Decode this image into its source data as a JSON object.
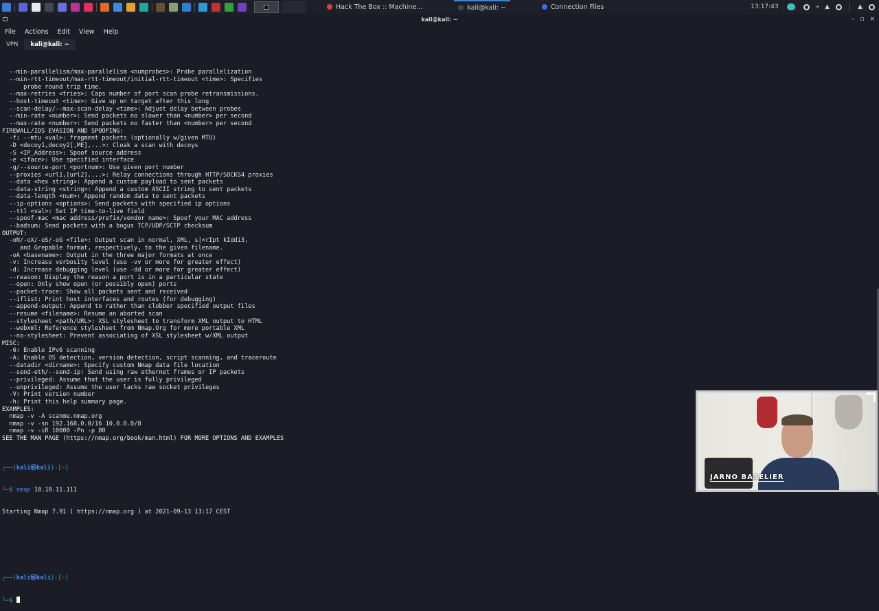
{
  "taskbar": {
    "icons": [
      {
        "name": "kali-menu-icon",
        "color": "#3b7bd6"
      },
      {
        "name": "workspace-icon",
        "color": "#5a63d8"
      },
      {
        "name": "file-manager-icon",
        "color": "#e8e8f0"
      },
      {
        "name": "terminal-icon",
        "color": "#444850"
      },
      {
        "name": "chat-icon",
        "color": "#6a6fe0"
      },
      {
        "name": "app-purple-icon",
        "color": "#c0309a"
      },
      {
        "name": "app-star-icon",
        "color": "#e03060"
      },
      {
        "name": "firefox-icon",
        "color": "#e06a20"
      },
      {
        "name": "browser-blue-icon",
        "color": "#3d8ae0"
      },
      {
        "name": "burp-icon",
        "color": "#e8a030"
      },
      {
        "name": "app-teal-icon",
        "color": "#1aa8a0"
      },
      {
        "name": "notes-icon",
        "color": "#6a5030"
      },
      {
        "name": "editor-icon",
        "color": "#8aa070"
      },
      {
        "name": "vscode-icon",
        "color": "#2d7fd0"
      },
      {
        "name": "app-cyan-icon",
        "color": "#2a9ad8"
      },
      {
        "name": "filezilla-icon",
        "color": "#c83030"
      },
      {
        "name": "lock-icon",
        "color": "#30a040"
      },
      {
        "name": "app-violet-icon",
        "color": "#7040c0"
      }
    ],
    "windows": [
      {
        "label": "Hack The Box :: Machine...",
        "color": "#e04040"
      },
      {
        "label": "kali@kali: ~",
        "color": "#444850"
      },
      {
        "label": "Connection Files",
        "color": "#3d6ee0"
      }
    ],
    "clock": "13:17:43"
  },
  "window": {
    "title": "kali@kali: ~",
    "controls": [
      "–",
      "▫",
      "×"
    ]
  },
  "menu": [
    "File",
    "Actions",
    "Edit",
    "View",
    "Help"
  ],
  "tabs": [
    {
      "label": "VPN"
    },
    {
      "label": "kali@kali: ~"
    }
  ],
  "terminal": {
    "lines": [
      {
        "t": "  --min-parallelism/max-parallelism <numprobes>: Probe parallelization"
      },
      {
        "t": "  --min-rtt-timeout/max-rtt-timeout/initial-rtt-timeout <time>: Specifies"
      },
      {
        "t": "      probe round trip time."
      },
      {
        "t": "  --max-retries <tries>: Caps number of port scan probe retransmissions."
      },
      {
        "t": "  --host-timeout <time>: Give up on target after this long"
      },
      {
        "t": "  --scan-delay/--max-scan-delay <time>: Adjust delay between probes"
      },
      {
        "t": "  --min-rate <number>: Send packets no slower than <number> per second"
      },
      {
        "t": "  --max-rate <number>: Send packets no faster than <number> per second"
      },
      {
        "t": "FIREWALL/IDS EVASION AND SPOOFING:"
      },
      {
        "t": "  -f; --mtu <val>: fragment packets (optionally w/given MTU)"
      },
      {
        "t": "  -D <decoy1,decoy2[,ME],...>: Cloak a scan with decoys"
      },
      {
        "t": "  -S <IP_Address>: Spoof source address"
      },
      {
        "t": "  -e <iface>: Use specified interface"
      },
      {
        "t": "  -g/--source-port <portnum>: Use given port number"
      },
      {
        "t": "  --proxies <url1,[url2],...>: Relay connections through HTTP/SOCKS4 proxies"
      },
      {
        "t": "  --data <hex string>: Append a custom payload to sent packets"
      },
      {
        "t": "  --data-string <string>: Append a custom ASCII string to sent packets"
      },
      {
        "t": "  --data-length <num>: Append random data to sent packets"
      },
      {
        "t": "  --ip-options <options>: Send packets with specified ip options"
      },
      {
        "t": "  --ttl <val>: Set IP time-to-live field"
      },
      {
        "t": "  --spoof-mac <mac address/prefix/vendor name>: Spoof your MAC address"
      },
      {
        "t": "  --badsum: Send packets with a bogus TCP/UDP/SCTP checksum"
      },
      {
        "t": "OUTPUT:"
      },
      {
        "t": "  -oN/-oX/-oS/-oG <file>: Output scan in normal, XML, s|<rIpt kIddi3,"
      },
      {
        "t": "     and Grepable format, respectively, to the given filename."
      },
      {
        "t": "  -oA <basename>: Output in the three major formats at once"
      },
      {
        "t": "  -v: Increase verbosity level (use -vv or more for greater effect)"
      },
      {
        "t": "  -d: Increase debugging level (use -dd or more for greater effect)"
      },
      {
        "t": "  --reason: Display the reason a port is in a particular state"
      },
      {
        "t": "  --open: Only show open (or possibly open) ports"
      },
      {
        "t": "  --packet-trace: Show all packets sent and received"
      },
      {
        "t": "  --iflist: Print host interfaces and routes (for debugging)"
      },
      {
        "t": "  --append-output: Append to rather than clobber specified output files"
      },
      {
        "t": "  --resume <filename>: Resume an aborted scan"
      },
      {
        "t": "  --stylesheet <path/URL>: XSL stylesheet to transform XML output to HTML"
      },
      {
        "t": "  --webxml: Reference stylesheet from Nmap.Org for more portable XML"
      },
      {
        "t": "  --no-stylesheet: Prevent associating of XSL stylesheet w/XML output"
      },
      {
        "t": "MISC:"
      },
      {
        "t": "  -6: Enable IPv6 scanning"
      },
      {
        "t": "  -A: Enable OS detection, version detection, script scanning, and traceroute"
      },
      {
        "t": "  --datadir <dirname>: Specify custom Nmap data file location"
      },
      {
        "t": "  --send-eth/--send-ip: Send using raw ethernet frames or IP packets"
      },
      {
        "t": "  --privileged: Assume that the user is fully privileged"
      },
      {
        "t": "  --unprivileged: Assume the user lacks raw socket privileges"
      },
      {
        "t": "  -V: Print version number"
      },
      {
        "t": "  -h: Print this help summary page."
      },
      {
        "t": "EXAMPLES:"
      },
      {
        "t": "  nmap -v -A scanme.nmap.org"
      },
      {
        "t": "  nmap -v -sn 192.168.0.0/16 10.0.0.0/8"
      },
      {
        "t": "  nmap -v -iR 10000 -Pn -p 80"
      },
      {
        "t": "SEE THE MAN PAGE (https://nmap.org/book/man.html) FOR MORE OPTIONS AND EXAMPLES"
      },
      {
        "t": ""
      }
    ],
    "prompt1": {
      "box_top": "┌──(",
      "user": "kali㉿kali",
      "box_end": ")-[~]",
      "box_bottom": "└─$ ",
      "cmd": "nmap",
      "args": " 10.10.11.111"
    },
    "output": "Starting Nmap 7.91 ( https://nmap.org ) at 2021-09-13 13:17 CEST",
    "prompt2": {
      "box_top": "┌──(",
      "user": "kali㉿kali",
      "box_end": ")-[~]",
      "box_bottom": "└─$ "
    }
  },
  "webcam": {
    "presenter_name": "JARNO BASELIER"
  }
}
